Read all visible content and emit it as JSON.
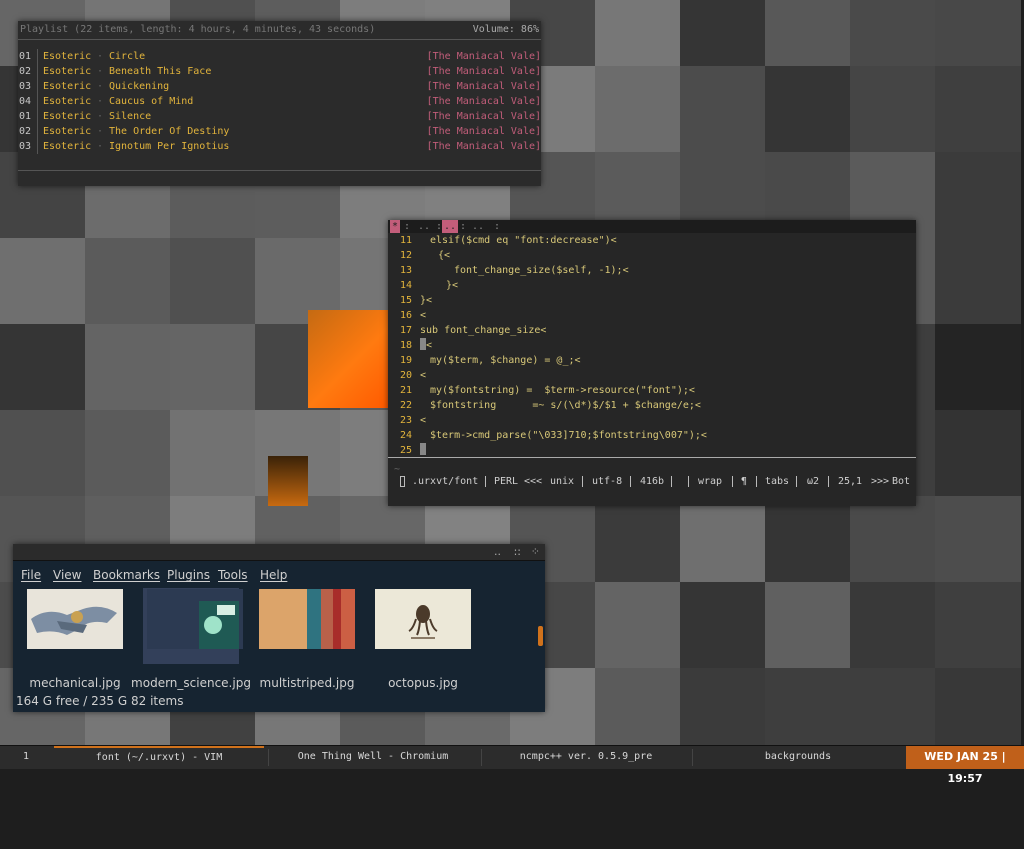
{
  "colors": {
    "accent": "#d0721c",
    "playlist_artist": "#e2b43c",
    "playlist_album": "#c25d7a",
    "vim_linenr": "#e2b43c",
    "fm_background": "#162431"
  },
  "playlist": {
    "header": "Playlist (22 items, length: 4 hours, 4 minutes, 43 seconds)",
    "volume": "Volume: 86%",
    "separator": "·",
    "tracks": [
      {
        "num": "01",
        "artist": "Esoteric",
        "title": "Circle",
        "album": "[The Maniacal Vale]"
      },
      {
        "num": "02",
        "artist": "Esoteric",
        "title": "Beneath This Face",
        "album": "[The Maniacal Vale]"
      },
      {
        "num": "03",
        "artist": "Esoteric",
        "title": "Quickening",
        "album": "[The Maniacal Vale]"
      },
      {
        "num": "04",
        "artist": "Esoteric",
        "title": "Caucus of Mind",
        "album": "[The Maniacal Vale]"
      },
      {
        "num": "01",
        "artist": "Esoteric",
        "title": "Silence",
        "album": "[The Maniacal Vale]"
      },
      {
        "num": "02",
        "artist": "Esoteric",
        "title": "The Order Of Destiny",
        "album": "[The Maniacal Vale]"
      },
      {
        "num": "03",
        "artist": "Esoteric",
        "title": "Ignotum Per Ignotius",
        "album": "[The Maniacal Vale]"
      }
    ]
  },
  "vim": {
    "tabs": [
      {
        "label": "*",
        "active": true
      },
      {
        "label": ":",
        "active": false
      },
      {
        "label": "..",
        "active": false
      },
      {
        "label": ":",
        "active": false
      },
      {
        "label": "..",
        "active": true
      },
      {
        "label": ":",
        "active": false
      },
      {
        "label": "..",
        "active": false
      },
      {
        "label": ":",
        "active": false
      }
    ],
    "lines": [
      {
        "n": "11",
        "indent": "ind1",
        "text": "elsif($cmd eq \"font:decrease\")<"
      },
      {
        "n": "12",
        "indent": "ind2",
        "text": "{<"
      },
      {
        "n": "13",
        "indent": "ind3",
        "text": "font_change_size($self, -1);<"
      },
      {
        "n": "14",
        "indent": "ind4",
        "text": "}<"
      },
      {
        "n": "15",
        "indent": "",
        "text": "}<"
      },
      {
        "n": "16",
        "indent": "",
        "text": "<"
      },
      {
        "n": "17",
        "indent": "",
        "text": "sub font_change_size<"
      },
      {
        "n": "18",
        "indent": "",
        "text": "{<",
        "cursor": true
      },
      {
        "n": "19",
        "indent": "ind1",
        "text": "my($term, $change) = @_;<"
      },
      {
        "n": "20",
        "indent": "",
        "text": "<"
      },
      {
        "n": "21",
        "indent": "ind1",
        "text": "my($fontstring) =  $term->resource(\"font\");<"
      },
      {
        "n": "22",
        "indent": "ind1",
        "text": "$fontstring      =~ s/(\\d*)$/$1 + $change/e;<"
      },
      {
        "n": "23",
        "indent": "",
        "text": "<"
      },
      {
        "n": "24",
        "indent": "ind1",
        "text": "$term->cmd_parse(\"\\033]710;$fontstring\\007\");<"
      },
      {
        "n": "25",
        "indent": "",
        "text": "<",
        "cursor": true
      }
    ],
    "tilde": "~",
    "status": {
      "file": ".urxvt/font",
      "filetype": "PERL",
      "arrows_left": "<<<",
      "fileformat": "unix",
      "encoding": "utf-8",
      "size": "416b",
      "wrap": "wrap",
      "pilcrow": "¶",
      "tabs": "tabs",
      "shiftwidth": "ω2",
      "position": "25,1",
      "arrows_right": ">>>",
      "scroll": "Bot"
    }
  },
  "filemanager": {
    "title_buttons": [
      "..",
      "::",
      "⁘"
    ],
    "menus": [
      "File",
      "View",
      "Bookmarks",
      "Plugins",
      "Tools",
      "Help"
    ],
    "files": [
      {
        "name": "mechanical.jpg",
        "icon": "image-thumbnail-mechanical"
      },
      {
        "name": "modern_science.jpg",
        "icon": "image-thumbnail-modern-science",
        "selected": true
      },
      {
        "name": "multistriped.jpg",
        "icon": "image-thumbnail-multistriped"
      },
      {
        "name": "octopus.jpg",
        "icon": "image-thumbnail-octopus"
      }
    ],
    "status": "164 G free / 235 G   82 items"
  },
  "panel": {
    "workspace": "1",
    "tasks": [
      {
        "label": "font (~/.urxvt) - VIM",
        "active": true
      },
      {
        "label": "One Thing Well - Chromium",
        "active": false
      },
      {
        "label": "ncmpc++ ver. 0.5.9_pre",
        "active": false
      },
      {
        "label": "backgrounds",
        "active": false
      }
    ],
    "clock": "WED JAN 25 | 19:57"
  }
}
